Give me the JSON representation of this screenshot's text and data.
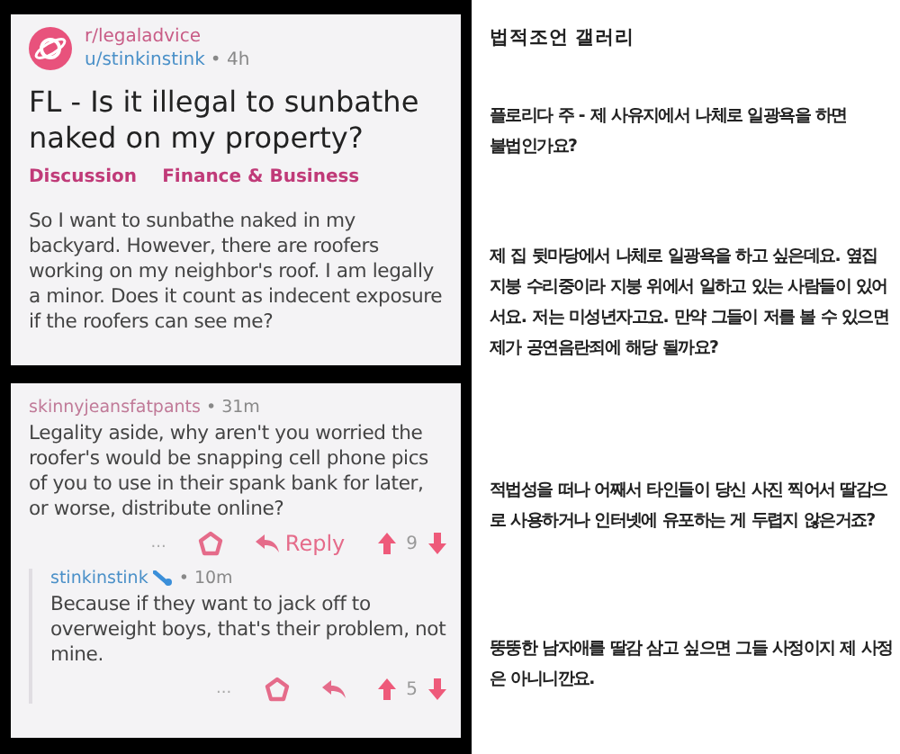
{
  "post": {
    "subreddit": "r/legaladvice",
    "author": "u/stinkinstink",
    "time": "• 4h",
    "title": "FL - Is it illegal to sunbathe naked on my property?",
    "flairs": [
      "Discussion",
      "Finance & Business"
    ],
    "body": "So I want to sunbathe naked in my backyard. However, there are roofers working on my neighbor's roof. I am legally a minor. Does it count as indecent exposure if the roofers can see me?"
  },
  "comments": [
    {
      "author": "skinnyjeansfatpants",
      "time": "• 31m",
      "op": false,
      "text": "Legality aside, why aren't you worried the roofer's would be snapping cell phone pics of you to use in their spank bank for later, or worse, distribute online?",
      "more": "...",
      "reply": "Reply",
      "score": "9"
    },
    {
      "author": "stinkinstink",
      "time": "• 10m",
      "op": true,
      "text": "Because if they want to jack off to overweight boys, that's their problem, not mine.",
      "more": "...",
      "score": "5"
    }
  ],
  "translation": {
    "heading": "법적조언 갤러리",
    "paragraphs": [
      "플로리다 주 - 제 사유지에서 나체로 일광욕을 하면 불법인가요?",
      "제 집 뒷마당에서 나체로 일광욕을 하고 싶은데요. 옆집 지붕 수리중이라 지붕 위에서 일하고 있는 사람들이 있어서요. 저는 미성년자고요. 만약 그들이 저를 볼 수 있으면 제가 공연음란죄에 해당 될까요?",
      "적법성을 떠나 어째서 타인들이 당신 사진 찍어서 딸감으로 사용하거나 인터넷에 유포하는 게 두렵지 않은거죠?",
      "뚱뚱한 남자애를 딸감 삼고 싶으면 그들 사정이지 제 사정은 아니니깐요."
    ]
  }
}
